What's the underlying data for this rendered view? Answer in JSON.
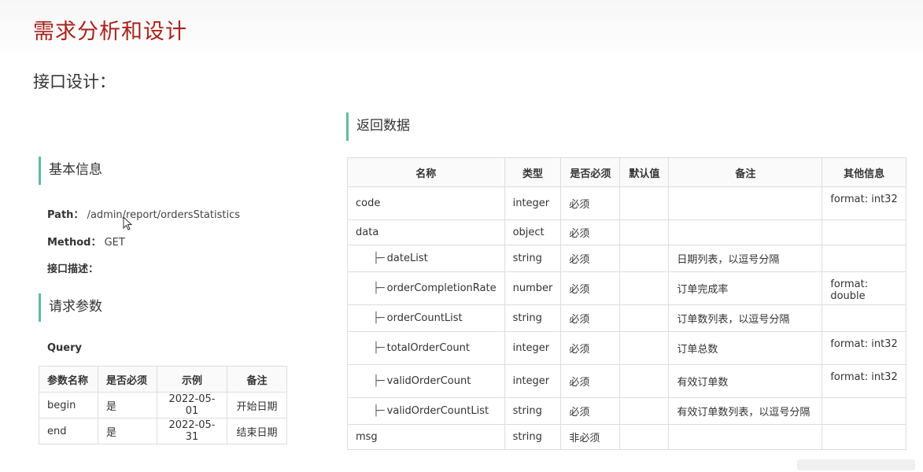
{
  "page": {
    "title": "需求分析和设计",
    "subtitle": "接口设计："
  },
  "basic_info": {
    "heading": "基本信息",
    "path_label": "Path：",
    "path_value": "/admin/report/ordersStatistics",
    "method_label": "Method：",
    "method_value": "GET",
    "desc_label": "接口描述："
  },
  "request_params": {
    "heading": "请求参数",
    "query_label": "Query",
    "headers": [
      "参数名称",
      "是否必须",
      "示例",
      "备注"
    ],
    "rows": [
      [
        "begin",
        "是",
        "2022-05-01",
        "开始日期"
      ],
      [
        "end",
        "是",
        "2022-05-31",
        "结束日期"
      ]
    ]
  },
  "response": {
    "heading": "返回数据",
    "headers": [
      "名称",
      "类型",
      "是否必须",
      "默认值",
      "备注",
      "其他信息"
    ],
    "tree_prefix": "├─",
    "rows": [
      {
        "name": "code",
        "type": "integer",
        "required": "必须",
        "default": "",
        "note": "",
        "other": "format: int32"
      },
      {
        "name": "data",
        "type": "object",
        "required": "必须",
        "default": "",
        "note": "",
        "other": ""
      },
      {
        "name": "dateList",
        "type": "string",
        "required": "必须",
        "default": "",
        "note": "日期列表，以逗号分隔",
        "other": ""
      },
      {
        "name": "orderCompletionRate",
        "type": "number",
        "required": "必须",
        "default": "",
        "note": "订单完成率",
        "other": "format: double"
      },
      {
        "name": "orderCountList",
        "type": "string",
        "required": "必须",
        "default": "",
        "note": "订单数列表，以逗号分隔",
        "other": ""
      },
      {
        "name": "totalOrderCount",
        "type": "integer",
        "required": "必须",
        "default": "",
        "note": "订单总数",
        "other": "format: int32"
      },
      {
        "name": "validOrderCount",
        "type": "integer",
        "required": "必须",
        "default": "",
        "note": "有效订单数",
        "other": "format: int32"
      },
      {
        "name": "validOrderCountList",
        "type": "string",
        "required": "必须",
        "default": "",
        "note": "有效订单数列表，以逗号分隔",
        "other": ""
      },
      {
        "name": "msg",
        "type": "string",
        "required": "非必须",
        "default": "",
        "note": "",
        "other": ""
      }
    ]
  }
}
